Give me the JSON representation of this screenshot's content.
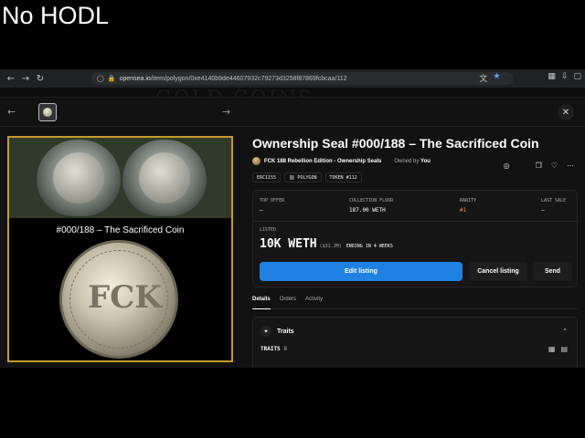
{
  "caption": "No HODL",
  "browser": {
    "url_host": "opensea.io",
    "url_path": "/item/polygon/0xe4140b9de44607932c79273d3258f87869fcbcaa/112",
    "icons": {
      "back": "back-arrow-icon",
      "forward": "forward-arrow-icon",
      "reload": "reload-icon"
    }
  },
  "background": {
    "title": "GOLD COINS"
  },
  "modal": {
    "item_title": "Ownership Seal #000/188 – The Sacrificed Coin",
    "collection_name": "FCK 188 Rebellion Edition - Ownership Seals",
    "owned_by_label": "Owned by",
    "owned_by_value": "You",
    "chips": [
      "ERC1155",
      "⛓ POLYGON",
      "TOKEN #112"
    ],
    "artwork_caption": "#000/188 – The Sacrificed Coin",
    "coin_text": "FCK",
    "stats": {
      "top_offer_label": "TOP OFFER",
      "top_offer_value": "–",
      "collection_floor_label": "COLLECTION FLOOR",
      "collection_floor_value": "187.00 WETH",
      "rarity_label": "RARITY",
      "rarity_value": "#1",
      "last_sale_label": "LAST SALE",
      "last_sale_value": "–"
    },
    "listing": {
      "label": "LISTED",
      "price": "10K WETH",
      "usd": "($31.2M)",
      "ending": "ENDING IN 4 WEEKS"
    },
    "buttons": {
      "edit": "Edit listing",
      "cancel": "Cancel listing",
      "send": "Send"
    },
    "tabs": [
      "Details",
      "Orders",
      "Activity"
    ],
    "traits": {
      "heading": "Traits",
      "count_label": "TRAITS",
      "count_value": "8"
    }
  }
}
